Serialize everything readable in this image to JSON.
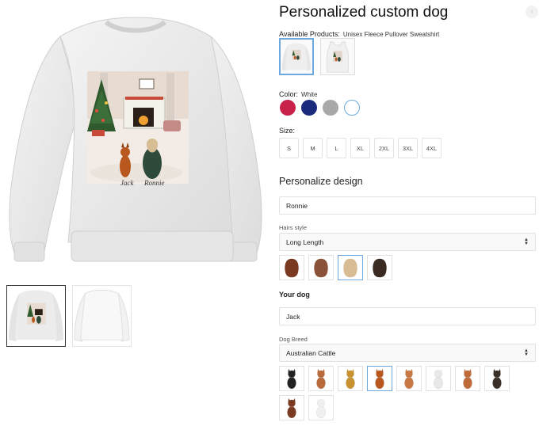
{
  "product": {
    "title": "Personalized custom dog"
  },
  "available_products": {
    "label": "Available Products:",
    "selected_name": "Unisex Fleece Pullover Sweatshirt",
    "items": [
      {
        "name": "sweatshirt-thumb",
        "selected": true
      },
      {
        "name": "tanktop-thumb",
        "selected": false
      }
    ]
  },
  "color": {
    "label": "Color:",
    "selected_name": "White",
    "swatches": [
      "#c8214a",
      "#1c2a7e",
      "#a8a8a8",
      "#ffffff"
    ],
    "selected_index": 3
  },
  "size": {
    "label": "Size:",
    "options": [
      "S",
      "M",
      "L",
      "XL",
      "2XL",
      "3XL",
      "4XL"
    ]
  },
  "personalize": {
    "title": "Personalize design",
    "name_value": "Ronnie",
    "hair_style_label": "Hairs style",
    "hair_style_value": "Long Length",
    "hair_colors": [
      "#7a3a22",
      "#8a5238",
      "#d8bc94",
      "#3a2a22"
    ],
    "hair_selected_index": 2,
    "dog_section_title": "Your dog",
    "dog_name_value": "Jack",
    "dog_breed_label": "Dog Breed",
    "dog_breed_value": "Australian Cattle",
    "breed_colors": [
      "#222222",
      "#b86a3a",
      "#c8922e",
      "#b8581e",
      "#c87842",
      "#e8e8e8",
      "#c06a3a",
      "#3a3028",
      "#7a3a22",
      "#f0f0f0"
    ],
    "breed_selected_index": 3
  },
  "artwork": {
    "dog_name": "Jack",
    "person_name": "Ronnie"
  },
  "colors": {
    "accent_border": "#6fa8dc",
    "shirt": "#ececec"
  }
}
